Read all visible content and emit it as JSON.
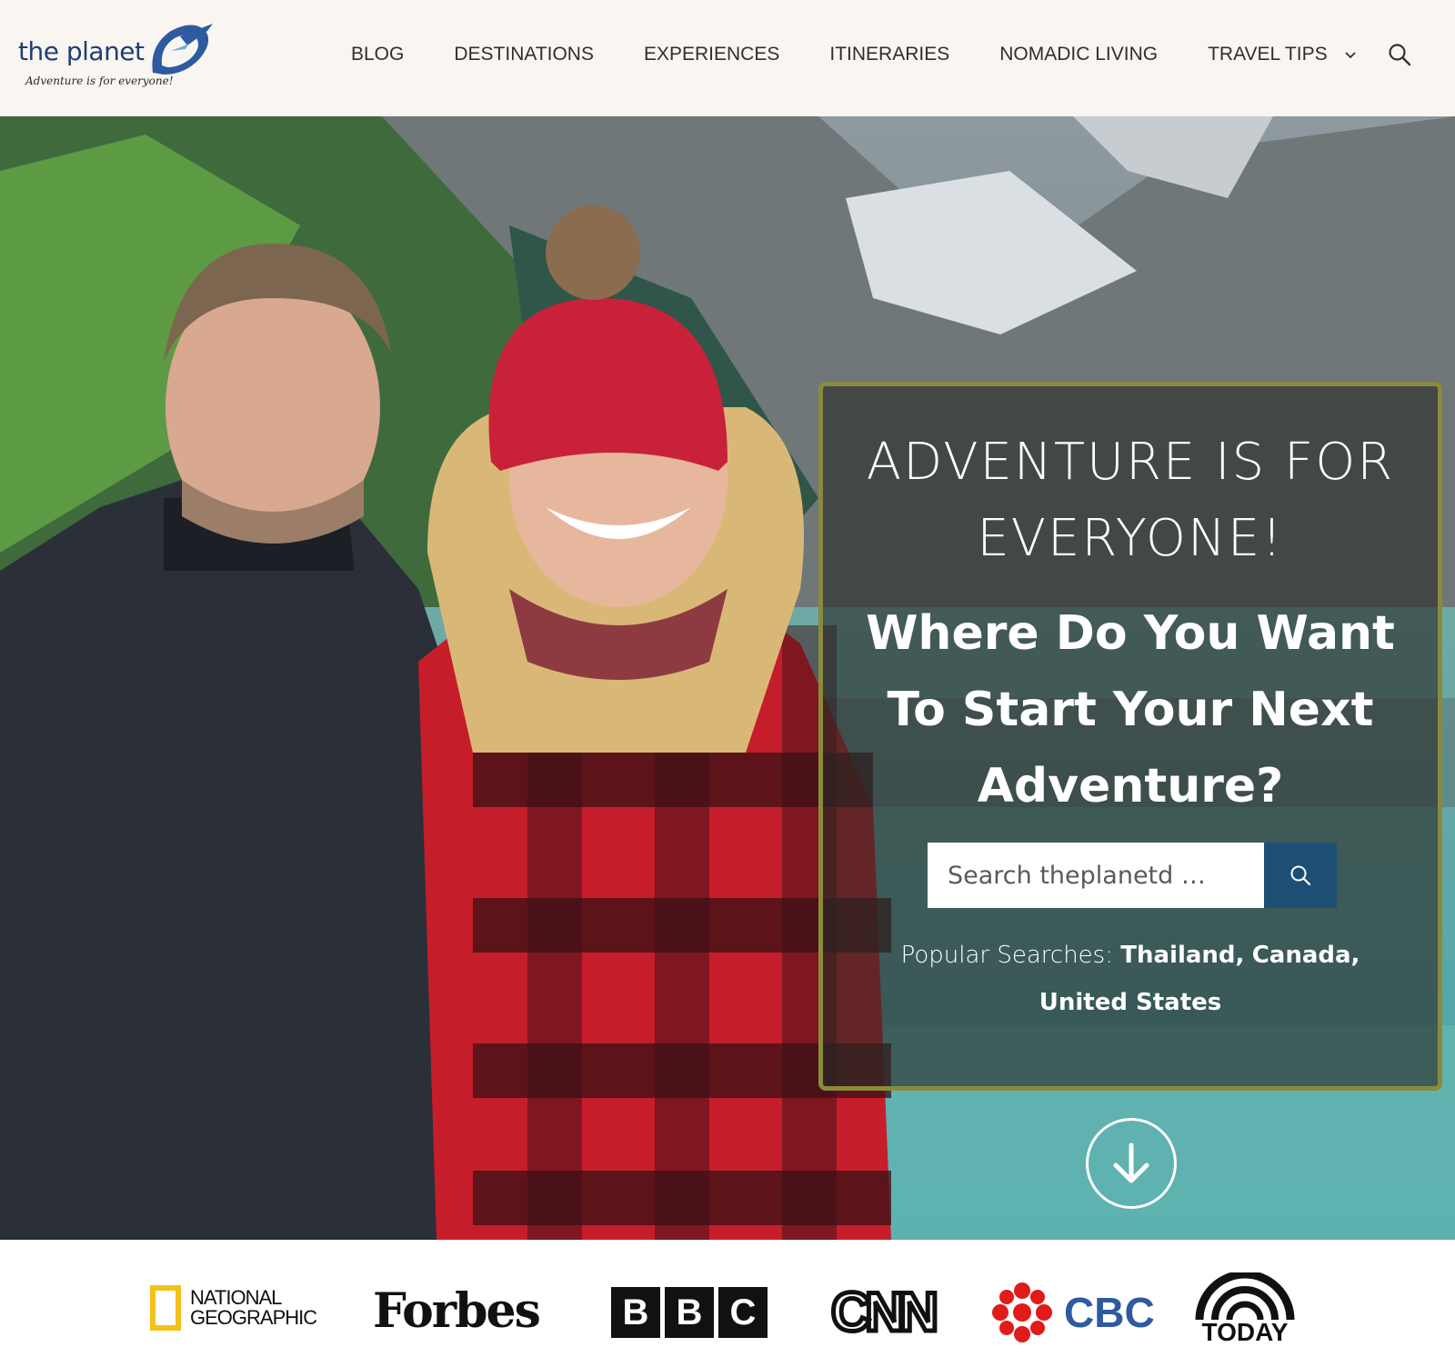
{
  "header": {
    "logo": {
      "name": "the planet",
      "tagline": "Adventure is for everyone!"
    },
    "nav": [
      {
        "label": "BLOG"
      },
      {
        "label": "DESTINATIONS"
      },
      {
        "label": "EXPERIENCES"
      },
      {
        "label": "ITINERARIES"
      },
      {
        "label": "NOMADIC LIVING"
      },
      {
        "label": "TRAVEL TIPS",
        "has_dropdown": true
      }
    ],
    "search_icon": "search-icon"
  },
  "hero": {
    "title": "ADVENTURE IS FOR EVERYONE!",
    "subtitle": "Where Do You Want To Start Your Next Adventure?",
    "search": {
      "placeholder": "Search theplanetd …"
    },
    "popular": {
      "label": "Popular Searches:",
      "links": [
        "Thailand,",
        "Canada,",
        "United States"
      ]
    },
    "scroll_icon": "arrow-down-circle-icon",
    "panel_border_color": "#8a8a3c",
    "search_button_color": "#1d4f74"
  },
  "press": {
    "logos": [
      {
        "name": "NATIONAL",
        "name2": "GEOGRAPHIC"
      },
      {
        "name": "Forbes"
      },
      {
        "name": "BBC",
        "letters": [
          "B",
          "B",
          "C"
        ]
      },
      {
        "name": "CNN"
      },
      {
        "name": "CBC"
      },
      {
        "name": "TODAY"
      }
    ]
  }
}
